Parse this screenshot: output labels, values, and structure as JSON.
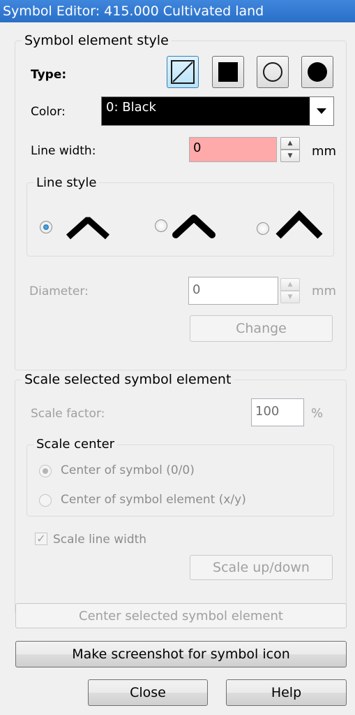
{
  "window": {
    "title": "Symbol Editor: 415.000 Cultivated land"
  },
  "style_group": {
    "title": "Symbol element style",
    "type_label": "Type:",
    "type_buttons": [
      {
        "name": "line",
        "active": true
      },
      {
        "name": "area",
        "active": false
      },
      {
        "name": "circle",
        "active": false
      },
      {
        "name": "dot",
        "active": false
      }
    ],
    "color_label": "Color:",
    "color_value": "0: Black",
    "line_width_label": "Line width:",
    "line_width_value": "0",
    "line_width_unit": "mm",
    "line_style": {
      "title": "Line style",
      "options": [
        {
          "style": "flat",
          "selected": true
        },
        {
          "style": "round",
          "selected": false
        },
        {
          "style": "miter",
          "selected": false
        }
      ]
    },
    "diameter_label": "Diameter:",
    "diameter_value": "0",
    "diameter_unit": "mm",
    "change_button": "Change"
  },
  "scale_group": {
    "title": "Scale selected symbol element",
    "scale_factor_label": "Scale factor:",
    "scale_factor_value": "100",
    "scale_factor_unit": "%",
    "scale_center": {
      "title": "Scale center",
      "option_symbol": "Center of symbol (0/0)",
      "option_element": "Center of symbol element (x/y)"
    },
    "scale_line_width_label": "Scale line width",
    "scale_line_width_checked": true,
    "scale_button": "Scale up/down"
  },
  "buttons": {
    "center": "Center selected symbol element",
    "screenshot": "Make screenshot for symbol icon",
    "close": "Close",
    "help": "Help"
  }
}
